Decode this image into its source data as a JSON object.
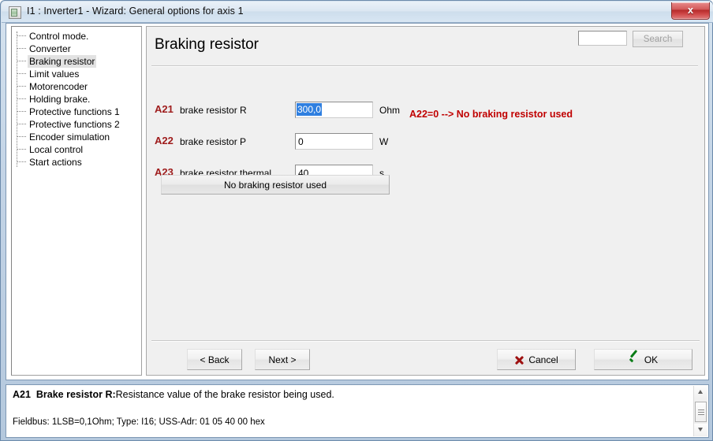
{
  "window": {
    "title": "I1 : Inverter1 - Wizard: General options for axis 1",
    "close_label": "x",
    "icon": "app-icon"
  },
  "sidebar": {
    "items": [
      {
        "label": "Control mode.",
        "selected": false
      },
      {
        "label": "Converter",
        "selected": false
      },
      {
        "label": "Braking resistor",
        "selected": true
      },
      {
        "label": "Limit values",
        "selected": false
      },
      {
        "label": "Motorencoder",
        "selected": false
      },
      {
        "label": "Holding brake.",
        "selected": false
      },
      {
        "label": "Protective functions 1",
        "selected": false
      },
      {
        "label": "Protective functions 2",
        "selected": false
      },
      {
        "label": "Encoder simulation",
        "selected": false
      },
      {
        "label": "Local control",
        "selected": false
      },
      {
        "label": "Start actions",
        "selected": false
      }
    ]
  },
  "content": {
    "page_title": "Braking resistor",
    "search": {
      "value": "",
      "placeholder": "",
      "button_label": "Search",
      "button_disabled": true
    },
    "parameters": [
      {
        "code": "A21",
        "label": "brake resistor R",
        "value": "300,0",
        "unit": "Ohm",
        "selected": true
      },
      {
        "code": "A22",
        "label": "brake resistor P",
        "value": "0",
        "unit": "W",
        "selected": false
      },
      {
        "code": "A23",
        "label": "brake resistor thermal",
        "value": "40",
        "unit": "s",
        "selected": false
      }
    ],
    "status_message": "A22=0 --> No braking resistor used",
    "status_color": "#c00000",
    "action_button_label": "No braking resistor used"
  },
  "buttons": {
    "back": "< Back",
    "next": "Next >",
    "cancel": "Cancel",
    "ok": "OK"
  },
  "help": {
    "code": "A21",
    "title": "Brake resistor R:",
    "description": "Resistance value of the brake resistor being used.",
    "fieldbus": "Fieldbus: 1LSB=0,1Ohm; Type: I16; USS-Adr: 01 05 40 00 hex"
  }
}
